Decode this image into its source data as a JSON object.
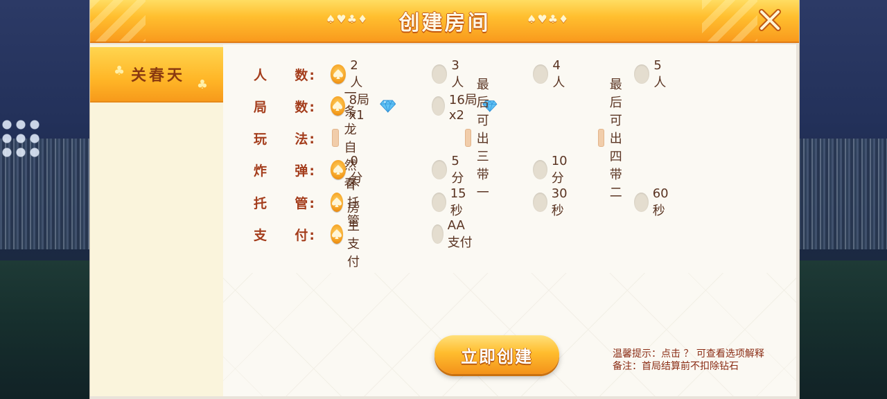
{
  "title": "创建房间",
  "title_suits": "♠♥♣♦",
  "sidebar": {
    "items": [
      {
        "label": "关春天"
      }
    ]
  },
  "rows": {
    "players": {
      "label_a": "人",
      "label_b": "数:",
      "options": [
        "2人",
        "3人",
        "4人",
        "5人"
      ],
      "selected": 0
    },
    "rounds": {
      "label_a": "局",
      "label_b": "数:",
      "options": [
        "8局x1",
        "16局x2"
      ],
      "selected": 0
    },
    "play": {
      "label_a": "玩",
      "label_b": "法:",
      "options": [
        "一条龙自然春",
        "最后可出三带一",
        "最后可出四带二"
      ]
    },
    "bomb": {
      "label_a": "炸",
      "label_b": "弹:",
      "options": [
        "0分",
        "5分",
        "10分"
      ],
      "selected": 0
    },
    "auto": {
      "label_a": "托",
      "label_b": "管:",
      "options": [
        "不托管",
        "15秒",
        "30秒",
        "60秒"
      ],
      "selected": 0
    },
    "payment": {
      "label_a": "支",
      "label_b": "付:",
      "options": [
        "房主支付",
        "AA支付"
      ],
      "selected": 0
    }
  },
  "create_button": "立即创建",
  "tips": {
    "line1": "温馨提示：点击 ？ 可查看选项解释",
    "line2": "备注：首局结算前不扣除钻石"
  },
  "colors": {
    "accent": "#f39a1a",
    "label": "#a43d1c",
    "title_bar": "#ffbf2f"
  },
  "icons": {
    "close": "close-icon",
    "diamond": "diamond-icon",
    "spade": "spade-icon"
  }
}
